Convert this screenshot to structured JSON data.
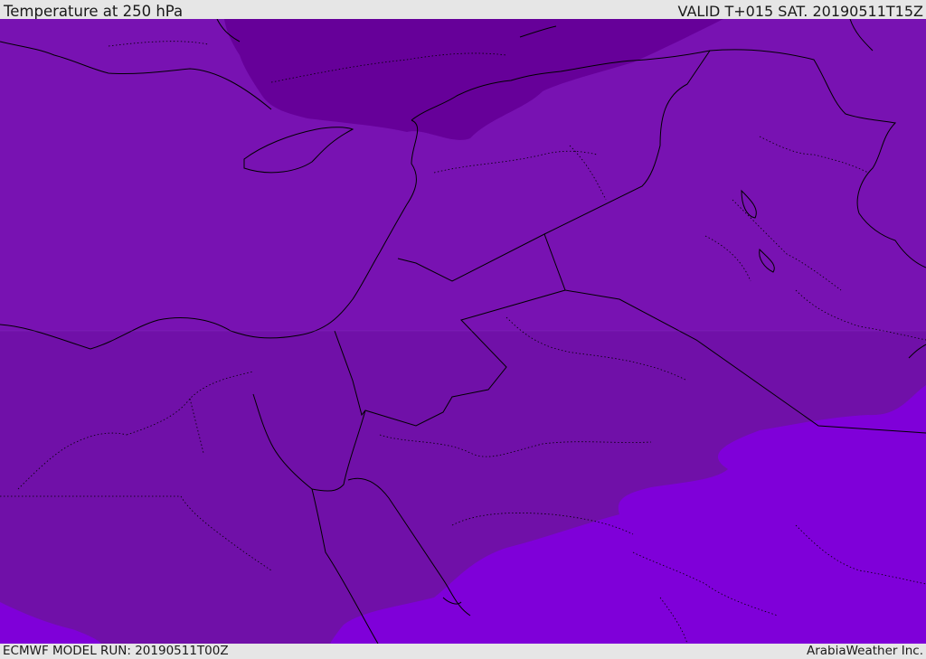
{
  "header": {
    "title": "Temperature at 250 hPa",
    "valid": "VALID T+015 SAT. 20190511T15Z"
  },
  "footer": {
    "model_run": "ECMWF MODEL RUN: 20190511T00Z",
    "brand": "ArabiaWeather Inc."
  },
  "colors": {
    "cold_band": "#660099",
    "mid_band": "#7810b0",
    "base_band": "#7010a8",
    "warm_band": "#7f00d9",
    "border_line": "#000000"
  }
}
